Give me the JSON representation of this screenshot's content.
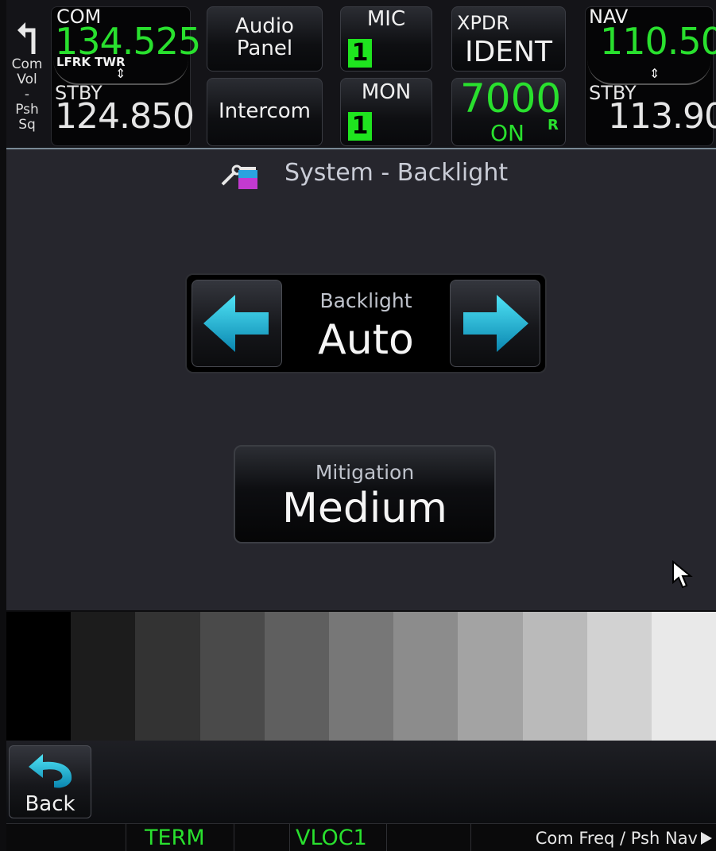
{
  "top_bar": {
    "com_vol": {
      "lines": [
        "Com",
        "Vol",
        "-",
        "Psh",
        "Sq"
      ]
    },
    "com": {
      "label": "COM",
      "active_freq": "134.525",
      "station": "LFRK TWR",
      "swap": "⇕",
      "stby_label": "STBY",
      "stby_freq": "124.850"
    },
    "audio_panel": {
      "line1": "Audio",
      "line2": "Panel"
    },
    "intercom": {
      "label": "Intercom"
    },
    "mic": {
      "label": "MIC",
      "value": "1"
    },
    "mon": {
      "label": "MON",
      "value": "1"
    },
    "xpdr": {
      "label": "XPDR",
      "ident": "IDENT",
      "code": "7000",
      "mode": "ON",
      "reply": "R"
    },
    "nav": {
      "label": "NAV",
      "active_freq": "110.50",
      "swap": "⇕",
      "stby_label": "STBY",
      "stby_freq": "113.90"
    }
  },
  "page": {
    "title": "System - Backlight",
    "backlight": {
      "label": "Backlight",
      "value": "Auto"
    },
    "mitigation": {
      "label": "Mitigation",
      "value": "Medium"
    }
  },
  "gray_scale": [
    "#000000",
    "#1c1c1c",
    "#333333",
    "#4a4a4a",
    "#5f5f5f",
    "#777777",
    "#8c8c8c",
    "#a3a3a3",
    "#bababa",
    "#d2d2d2",
    "#e9e9e9"
  ],
  "bottom": {
    "back_label": "Back"
  },
  "status_bar": {
    "term": "TERM",
    "vloc": "VLOC1",
    "hint": "Com Freq / Psh Nav"
  },
  "colors": {
    "accent_cyan": "#1bb9d6",
    "active_green": "#29e02e"
  }
}
